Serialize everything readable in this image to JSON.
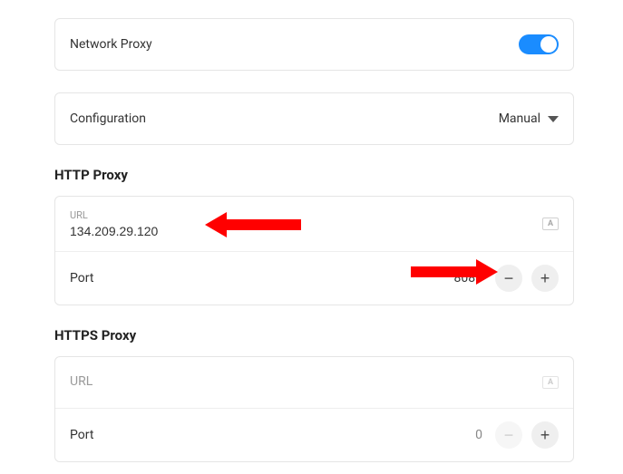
{
  "network_proxy": {
    "label": "Network Proxy",
    "enabled": true
  },
  "configuration": {
    "label": "Configuration",
    "value": "Manual"
  },
  "http_proxy": {
    "title": "HTTP Proxy",
    "url_label": "URL",
    "url_value": "134.209.29.120",
    "port_label": "Port",
    "port_value": "8080"
  },
  "https_proxy": {
    "title": "HTTPS Proxy",
    "url_label": "URL",
    "url_value": "",
    "port_label": "Port",
    "port_value": "0"
  }
}
